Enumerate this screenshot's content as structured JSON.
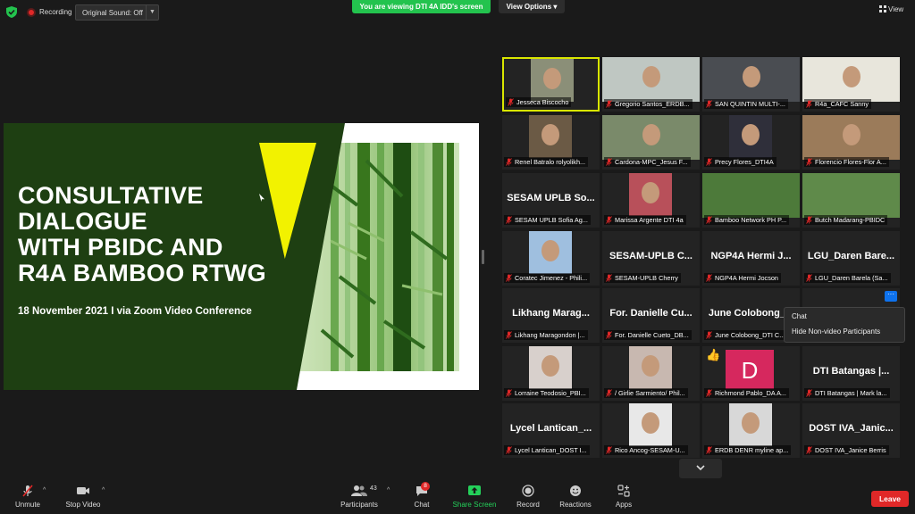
{
  "topbar": {
    "recording_label": "Recording",
    "original_sound": "Original Sound: Off",
    "viewing_banner": "You are viewing DTI 4A IDD's screen",
    "view_options": "View Options",
    "view_label": "View"
  },
  "slide": {
    "title_lines": [
      "CONSULTATIVE",
      "DIALOGUE",
      "WITH PBIDC AND",
      "R4A BAMBOO RTWG"
    ],
    "subtitle": "18 November 2021 I via Zoom Video Conference"
  },
  "participants": [
    {
      "name": "Jesseca Biscocho",
      "big": ""
    },
    {
      "name": "Gregorio Santos_ERDB...",
      "big": ""
    },
    {
      "name": "SAN QUINTIN MULTI-...",
      "big": ""
    },
    {
      "name": "R4a_CAFC Sanny",
      "big": ""
    },
    {
      "name": "Renel Batralo rolyolikh...",
      "big": ""
    },
    {
      "name": "Cardona-MPC_Jesus F...",
      "big": ""
    },
    {
      "name": "Precy Flores_DTI4A",
      "big": ""
    },
    {
      "name": "Florencio Flores-Flor A...",
      "big": ""
    },
    {
      "name": "SESAM UPLB Sofia Ag...",
      "big": "SESAM UPLB So..."
    },
    {
      "name": "Marissa Argente DTI 4a",
      "big": ""
    },
    {
      "name": "Bamboo Network PH P...",
      "big": ""
    },
    {
      "name": "Butch Madarang-PBIDC",
      "big": ""
    },
    {
      "name": "Coratec Jimenez - Phili...",
      "big": ""
    },
    {
      "name": "SESAM-UPLB Cherry",
      "big": "SESAM-UPLB C..."
    },
    {
      "name": "NGP4A Hermi Jocson",
      "big": "NGP4A Hermi J..."
    },
    {
      "name": "LGU_Daren Barela (Sa...",
      "big": "LGU_Daren Bare..."
    },
    {
      "name": "Likhang Maragondon |...",
      "big": "Likhang Marag..."
    },
    {
      "name": "For. Danielle Cueto_DB...",
      "big": "For. Danielle Cu..."
    },
    {
      "name": "June Colobong_DTI C...",
      "big": "June Colobong_..."
    },
    {
      "name": "",
      "big": ""
    },
    {
      "name": "Lorraine Teodosio_PBI...",
      "big": ""
    },
    {
      "name": "/ Girlie Sarmiento/ Phil...",
      "big": ""
    },
    {
      "name": "Richmond Pablo_DA A...",
      "big": ""
    },
    {
      "name": "DTI Batangas | Mark la...",
      "big": "DTI Batangas |..."
    },
    {
      "name": "Lycel Lantican_DOST I...",
      "big": "Lycel Lantican_..."
    },
    {
      "name": "Rico Ancog-SESAM-U...",
      "big": ""
    },
    {
      "name": "ERDB DENR myline ap...",
      "big": ""
    },
    {
      "name": "DOST IVA_Janice Berris",
      "big": "DOST IVA_Janic..."
    }
  ],
  "avatar_letter": "D",
  "more_dots": "···",
  "menu": {
    "chat": "Chat",
    "hide_non_video": "Hide Non-video Participants"
  },
  "toolbar": {
    "unmute": "Unmute",
    "stop_video": "Stop Video",
    "participants": "Participants",
    "participants_count": "43",
    "chat": "Chat",
    "chat_badge": "8",
    "share_screen": "Share Screen",
    "record": "Record",
    "reactions": "Reactions",
    "apps": "Apps",
    "leave": "Leave"
  },
  "colors": {
    "share_green": "#23c34e",
    "leave_red": "#e02828",
    "speaker_border": "#d9e600",
    "slide_green": "#1e3f12",
    "slide_yellow": "#f2f200",
    "avatar_pink": "#d6285e"
  }
}
